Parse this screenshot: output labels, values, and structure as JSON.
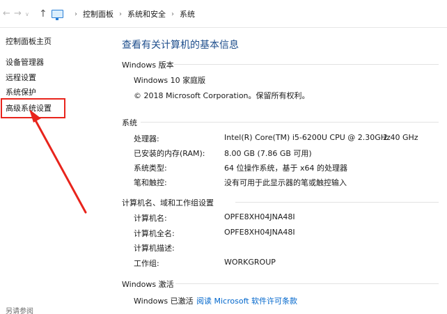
{
  "address_bar": {
    "back_glyph": "←",
    "forward_glyph": "→",
    "dropdown_glyph": "∨",
    "up_glyph": "↑",
    "separator": "›",
    "crumbs": [
      "控制面板",
      "系统和安全",
      "系统"
    ]
  },
  "left_pane": {
    "home": "控制面板主页",
    "links": [
      "设备管理器",
      "远程设置",
      "系统保护",
      "高级系统设置"
    ],
    "see_also": "另请参阅"
  },
  "main": {
    "title": "查看有关计算机的基本信息",
    "windows_edition": {
      "header": "Windows 版本",
      "edition": "Windows 10 家庭版",
      "copyright": "© 2018 Microsoft Corporation。保留所有权利。"
    },
    "system": {
      "header": "系统",
      "rows": [
        {
          "label": "处理器:",
          "value": "Intel(R) Core(TM) i5-6200U CPU @ 2.30GHz",
          "extra": "2.40 GHz"
        },
        {
          "label": "已安装的内存(RAM):",
          "value": "8.00 GB (7.86 GB 可用)"
        },
        {
          "label": "系统类型:",
          "value": "64 位操作系统，基于 x64 的处理器"
        },
        {
          "label": "笔和触控:",
          "value": "没有可用于此显示器的笔或触控输入"
        }
      ]
    },
    "computer": {
      "header": "计算机名、域和工作组设置",
      "rows": [
        {
          "label": "计算机名:",
          "value": "OPFE8XH04JNA48I"
        },
        {
          "label": "计算机全名:",
          "value": "OPFE8XH04JNA48I"
        },
        {
          "label": "计算机描述:",
          "value": ""
        },
        {
          "label": "工作组:",
          "value": "WORKGROUP"
        }
      ]
    },
    "activation": {
      "header": "Windows 激活",
      "status": "Windows 已激活",
      "license_link": "阅读 Microsoft 软件许可条款"
    }
  },
  "colors": {
    "title_blue": "#1e4e8c",
    "link_blue": "#0066cc",
    "annotation_red": "#e8241c"
  },
  "icons": {
    "address_icon": "computer-monitor-icon",
    "annotation": "red-arrow-pointing-to-advanced-settings"
  }
}
